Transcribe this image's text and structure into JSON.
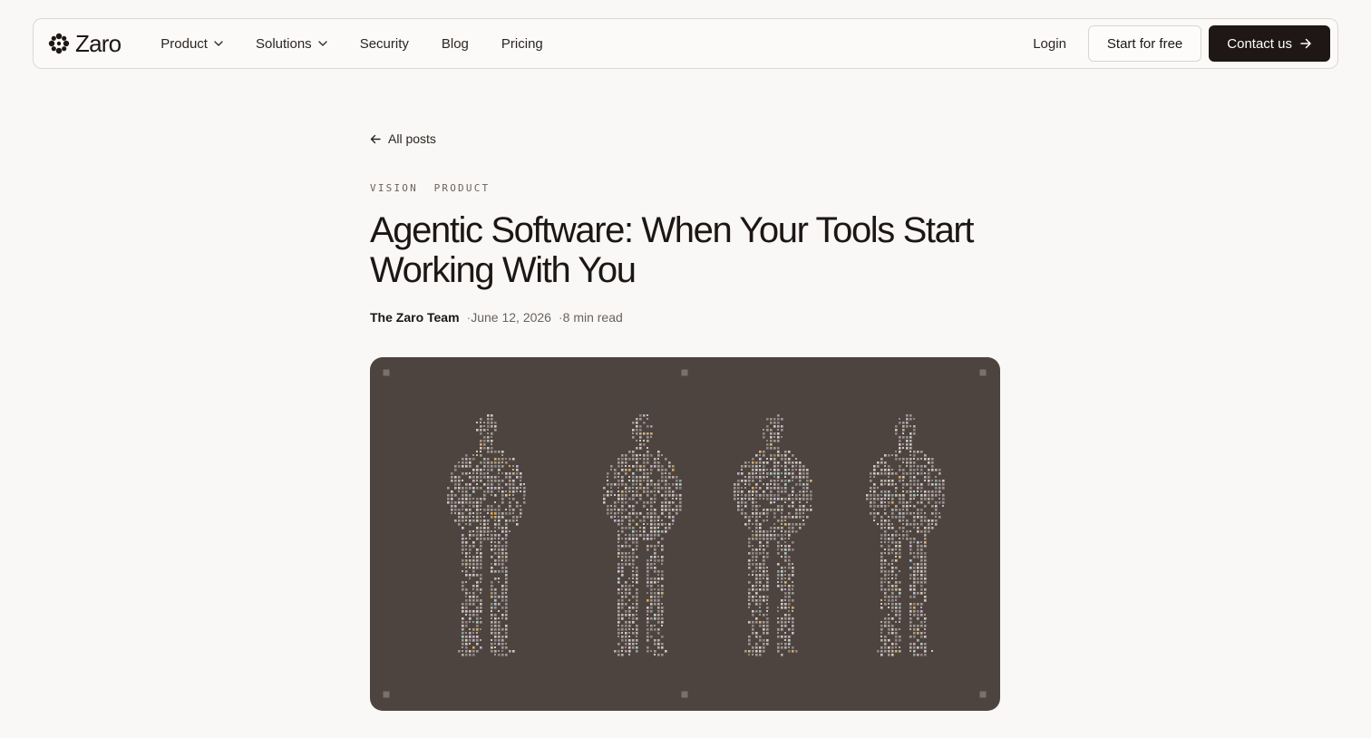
{
  "brand": {
    "name": "Zaro",
    "logo_icon": "zaro-flower-logo"
  },
  "nav": {
    "links": [
      {
        "label": "Product",
        "has_dropdown": true
      },
      {
        "label": "Solutions",
        "has_dropdown": true
      },
      {
        "label": "Security",
        "has_dropdown": false
      },
      {
        "label": "Blog",
        "has_dropdown": false
      },
      {
        "label": "Pricing",
        "has_dropdown": false
      }
    ],
    "login_label": "Login",
    "start_label": "Start for free",
    "contact_label": "Contact us"
  },
  "article": {
    "back_label": "All posts",
    "category": "VISION  PRODUCT",
    "title": "Agentic Software: When Your Tools Start Working With You",
    "author": "The Zaro Team",
    "date": "June 12, 2026",
    "read_time": "8 min read",
    "hero_image": "pixelated-people-figures"
  },
  "colors": {
    "background": "#f9f8f6",
    "primary_button": "#1e1715",
    "hero_background": "#4d4440",
    "text": "#1c1614"
  }
}
